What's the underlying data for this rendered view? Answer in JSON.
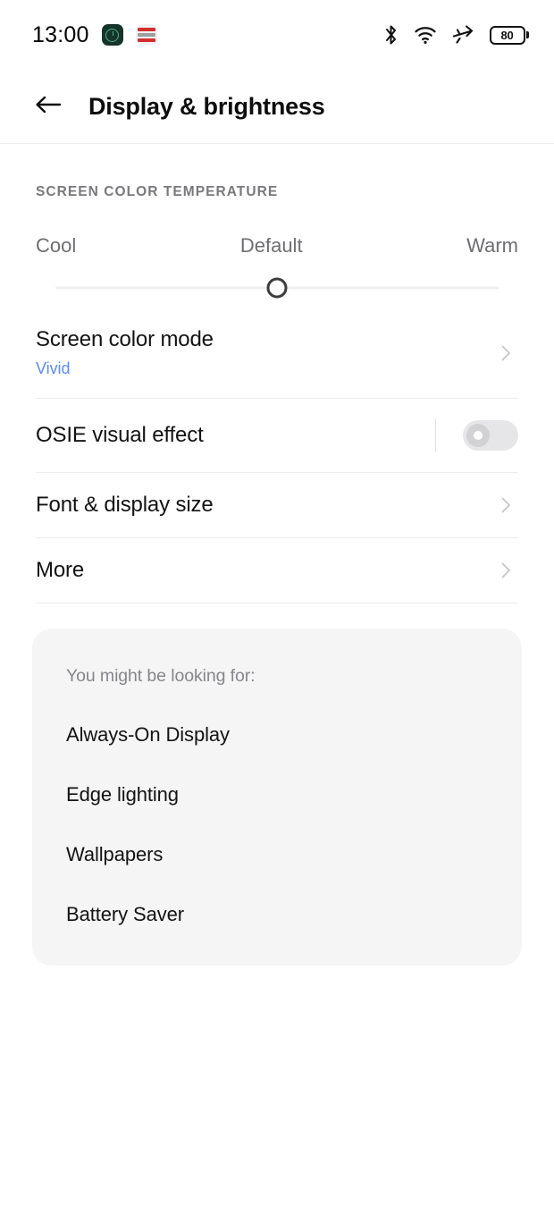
{
  "status_bar": {
    "time": "13:00",
    "notification_icons": [
      {
        "name": "clock-app-icon"
      },
      {
        "name": "red-app-icon"
      }
    ],
    "system_icons": [
      {
        "name": "bluetooth-icon"
      },
      {
        "name": "wifi-icon"
      },
      {
        "name": "airplane-mode-icon"
      }
    ],
    "battery_level": "80"
  },
  "header": {
    "title": "Display & brightness",
    "back_icon": "back-arrow-icon"
  },
  "screen_color_temperature": {
    "section_label": "SCREEN COLOR TEMPERATURE",
    "labels": {
      "cool": "Cool",
      "default": "Default",
      "warm": "Warm"
    },
    "slider_position_percent": 50
  },
  "rows": [
    {
      "title": "Screen color mode",
      "subtitle": "Vivid",
      "type": "chevron"
    },
    {
      "title": "OSIE visual effect",
      "type": "toggle",
      "toggle_on": false
    },
    {
      "title": "Font & display size",
      "type": "chevron"
    },
    {
      "title": "More",
      "type": "chevron"
    }
  ],
  "suggestions_card": {
    "heading": "You might be looking for:",
    "items": [
      "Always-On Display",
      "Edge lighting",
      "Wallpapers",
      "Battery Saver"
    ]
  },
  "colors": {
    "accent_blue": "#5b8def",
    "text_primary": "#131313",
    "text_secondary": "#6e6e72",
    "card_background": "#f5f5f6",
    "divider": "#ededed"
  }
}
